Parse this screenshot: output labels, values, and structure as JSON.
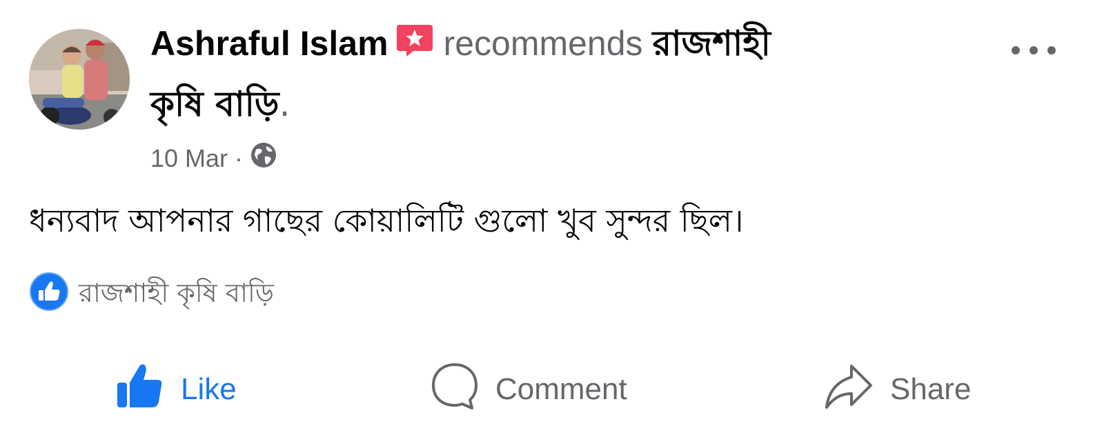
{
  "post": {
    "author_name": "Ashraful Islam",
    "recommendation_icon": "recommendation-flag-icon",
    "verb": "recommends",
    "page_name_part1": "রাজশাহী",
    "page_name_part2": "কৃষি বাড়ি",
    "period": ".",
    "timestamp": "10 Mar",
    "separator": "·",
    "privacy_icon": "globe-icon",
    "more_icon": "more-options-icon",
    "body": "ধন্যবাদ আপনার গাছের কোয়ালিটি গুলো খুব সুন্দর ছিল।",
    "reaction": {
      "icon": "like-reaction-icon",
      "reactor_name": "রাজশাহী কৃষি বাড়ি"
    }
  },
  "actions": {
    "like_label": "Like",
    "comment_label": "Comment",
    "share_label": "Share"
  },
  "colors": {
    "primary_text": "#050505",
    "secondary_text": "#65676b",
    "like_blue": "#1877f2",
    "recommend_red": "#f3425f"
  }
}
